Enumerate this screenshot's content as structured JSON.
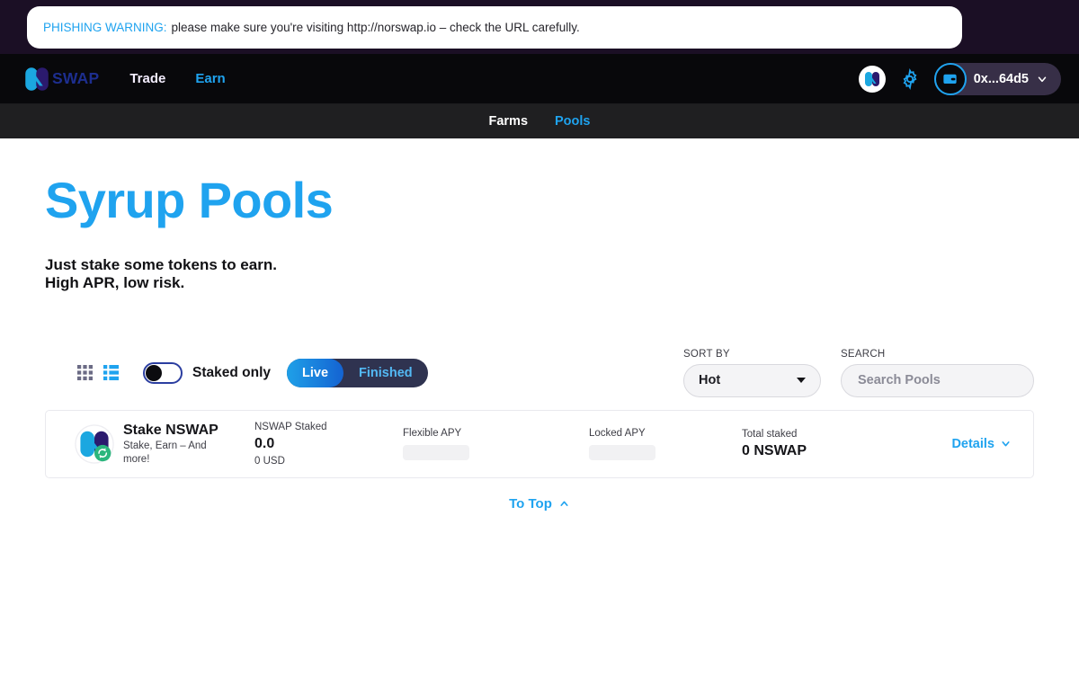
{
  "phishing": {
    "label": "PHISHING WARNING:",
    "message": "please make sure you're visiting http://norswap.io – check the URL carefully."
  },
  "header": {
    "brand": "SWAP",
    "nav": [
      {
        "label": "Trade",
        "active": false
      },
      {
        "label": "Earn",
        "active": true
      }
    ],
    "wallet_address": "0x...64d5",
    "icons": {
      "logo": "norswap-logo-icon",
      "gear": "gear-icon",
      "wallet": "wallet-icon",
      "chevron": "chevron-down-icon"
    }
  },
  "subnav": [
    {
      "label": "Farms",
      "active": false
    },
    {
      "label": "Pools",
      "active": true
    }
  ],
  "hero": {
    "title": "Syrup Pools",
    "subtitle_line1": "Just stake some tokens to earn.",
    "subtitle_line2": "High APR, low risk."
  },
  "controls": {
    "grid_view_icon": "grid-view-icon",
    "list_view_icon": "list-view-icon",
    "staked_only_label": "Staked only",
    "staked_only_on": false,
    "status_options": [
      {
        "label": "Live",
        "active": true
      },
      {
        "label": "Finished",
        "active": false
      }
    ],
    "sort_by_label": "SORT BY",
    "sort_by_value": "Hot",
    "search_label": "SEARCH",
    "search_placeholder": "Search Pools",
    "search_value": ""
  },
  "pools": [
    {
      "title": "Stake NSWAP",
      "description": "Stake, Earn – And more!",
      "staked_label": "NSWAP Staked",
      "staked_value": "0.0",
      "staked_usd": "0 USD",
      "flexible_apy_label": "Flexible APY",
      "flexible_apy_value": "",
      "locked_apy_label": "Locked APY",
      "locked_apy_value": "",
      "total_staked_label": "Total staked",
      "total_staked_value": "0 NSWAP",
      "details_label": "Details"
    }
  ],
  "footer": {
    "to_top_label": "To Top"
  },
  "colors": {
    "accent_blue": "#1fa3ef",
    "brand_purple": "#2b1a6e",
    "logo_cyan": "#1ba7e0",
    "dark_header": "#08080b",
    "phish_strip": "#1b0f25",
    "subnav_bg": "#1f1f21",
    "pill_track": "#2f3350",
    "wallet_pill": "#372f47"
  }
}
